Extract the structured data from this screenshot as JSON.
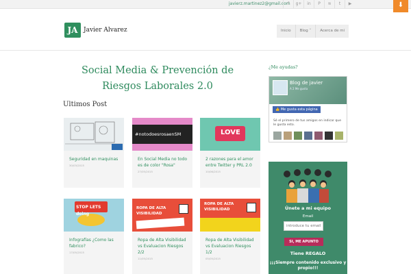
{
  "topbar": {
    "email": "javierz.martinez2@gmail.com",
    "social": [
      "f-icon",
      "gplus-icon",
      "in-icon",
      "pinterest-icon",
      "rss-icon",
      "twitter-icon",
      "youtube-icon"
    ]
  },
  "header": {
    "logo_mark": "JA",
    "logo_text": "Javier Alvarez",
    "nav": [
      "Inicio",
      "Blog ˅",
      "Acerca de mi"
    ]
  },
  "main": {
    "title": "Social Media & Prevención de Riesgos Laborales 2.0",
    "section": "Ultimos Post",
    "posts": [
      {
        "title": "Seguridad en maquinas",
        "date": "30/03/2015",
        "thumb_text": ""
      },
      {
        "title": "En Social Media no todo es de color \"Rosa\"",
        "date": "27/05/2015",
        "thumb_text": "#notodoesrosaenSM"
      },
      {
        "title": "2 razones para el amor entre Twitter y PRL 2.0",
        "date": "10/06/2015",
        "thumb_text": "LOVE"
      },
      {
        "title": "Infografías ¿Como las fabrico?",
        "date": "17/05/2015",
        "thumb_text": "STOP LETS doing"
      },
      {
        "title": "Ropa de Alta Visibilidad vs Evaluacion Riesgos 2/2",
        "date": "11/05/2015",
        "thumb_text": "ROPA DE ALTA VISIBILIDAD"
      },
      {
        "title": "Ropa de Alta Visibilidad vs Evaluacion Riesgos 1/2",
        "date": "05/05/2015",
        "thumb_text": "ROPA DE ALTA VISIBILIDAD"
      }
    ]
  },
  "sidebar": {
    "question": "¿Me ayudas?",
    "fb": {
      "page_name": "Blog de javier",
      "page_sub": "A 2 Me gusta",
      "like": "Me gusta esta página",
      "friends": "Sé el primero de tus amigos en indicar que le gusta esto."
    },
    "promo": {
      "join": "Únete a mi equipo",
      "email_label": "Email",
      "email_placeholder": "introduce tu email",
      "button": "SI, ME APUNTO",
      "gift": "Tiene REGALO",
      "exclusive": "¡¡¡Siempre contenido exclusivo y propio!!!"
    }
  },
  "colors": {
    "accent": "#2e8a5d",
    "promo": "#3f8a6a",
    "button": "#b72c5a",
    "download": "#f08a2a"
  }
}
